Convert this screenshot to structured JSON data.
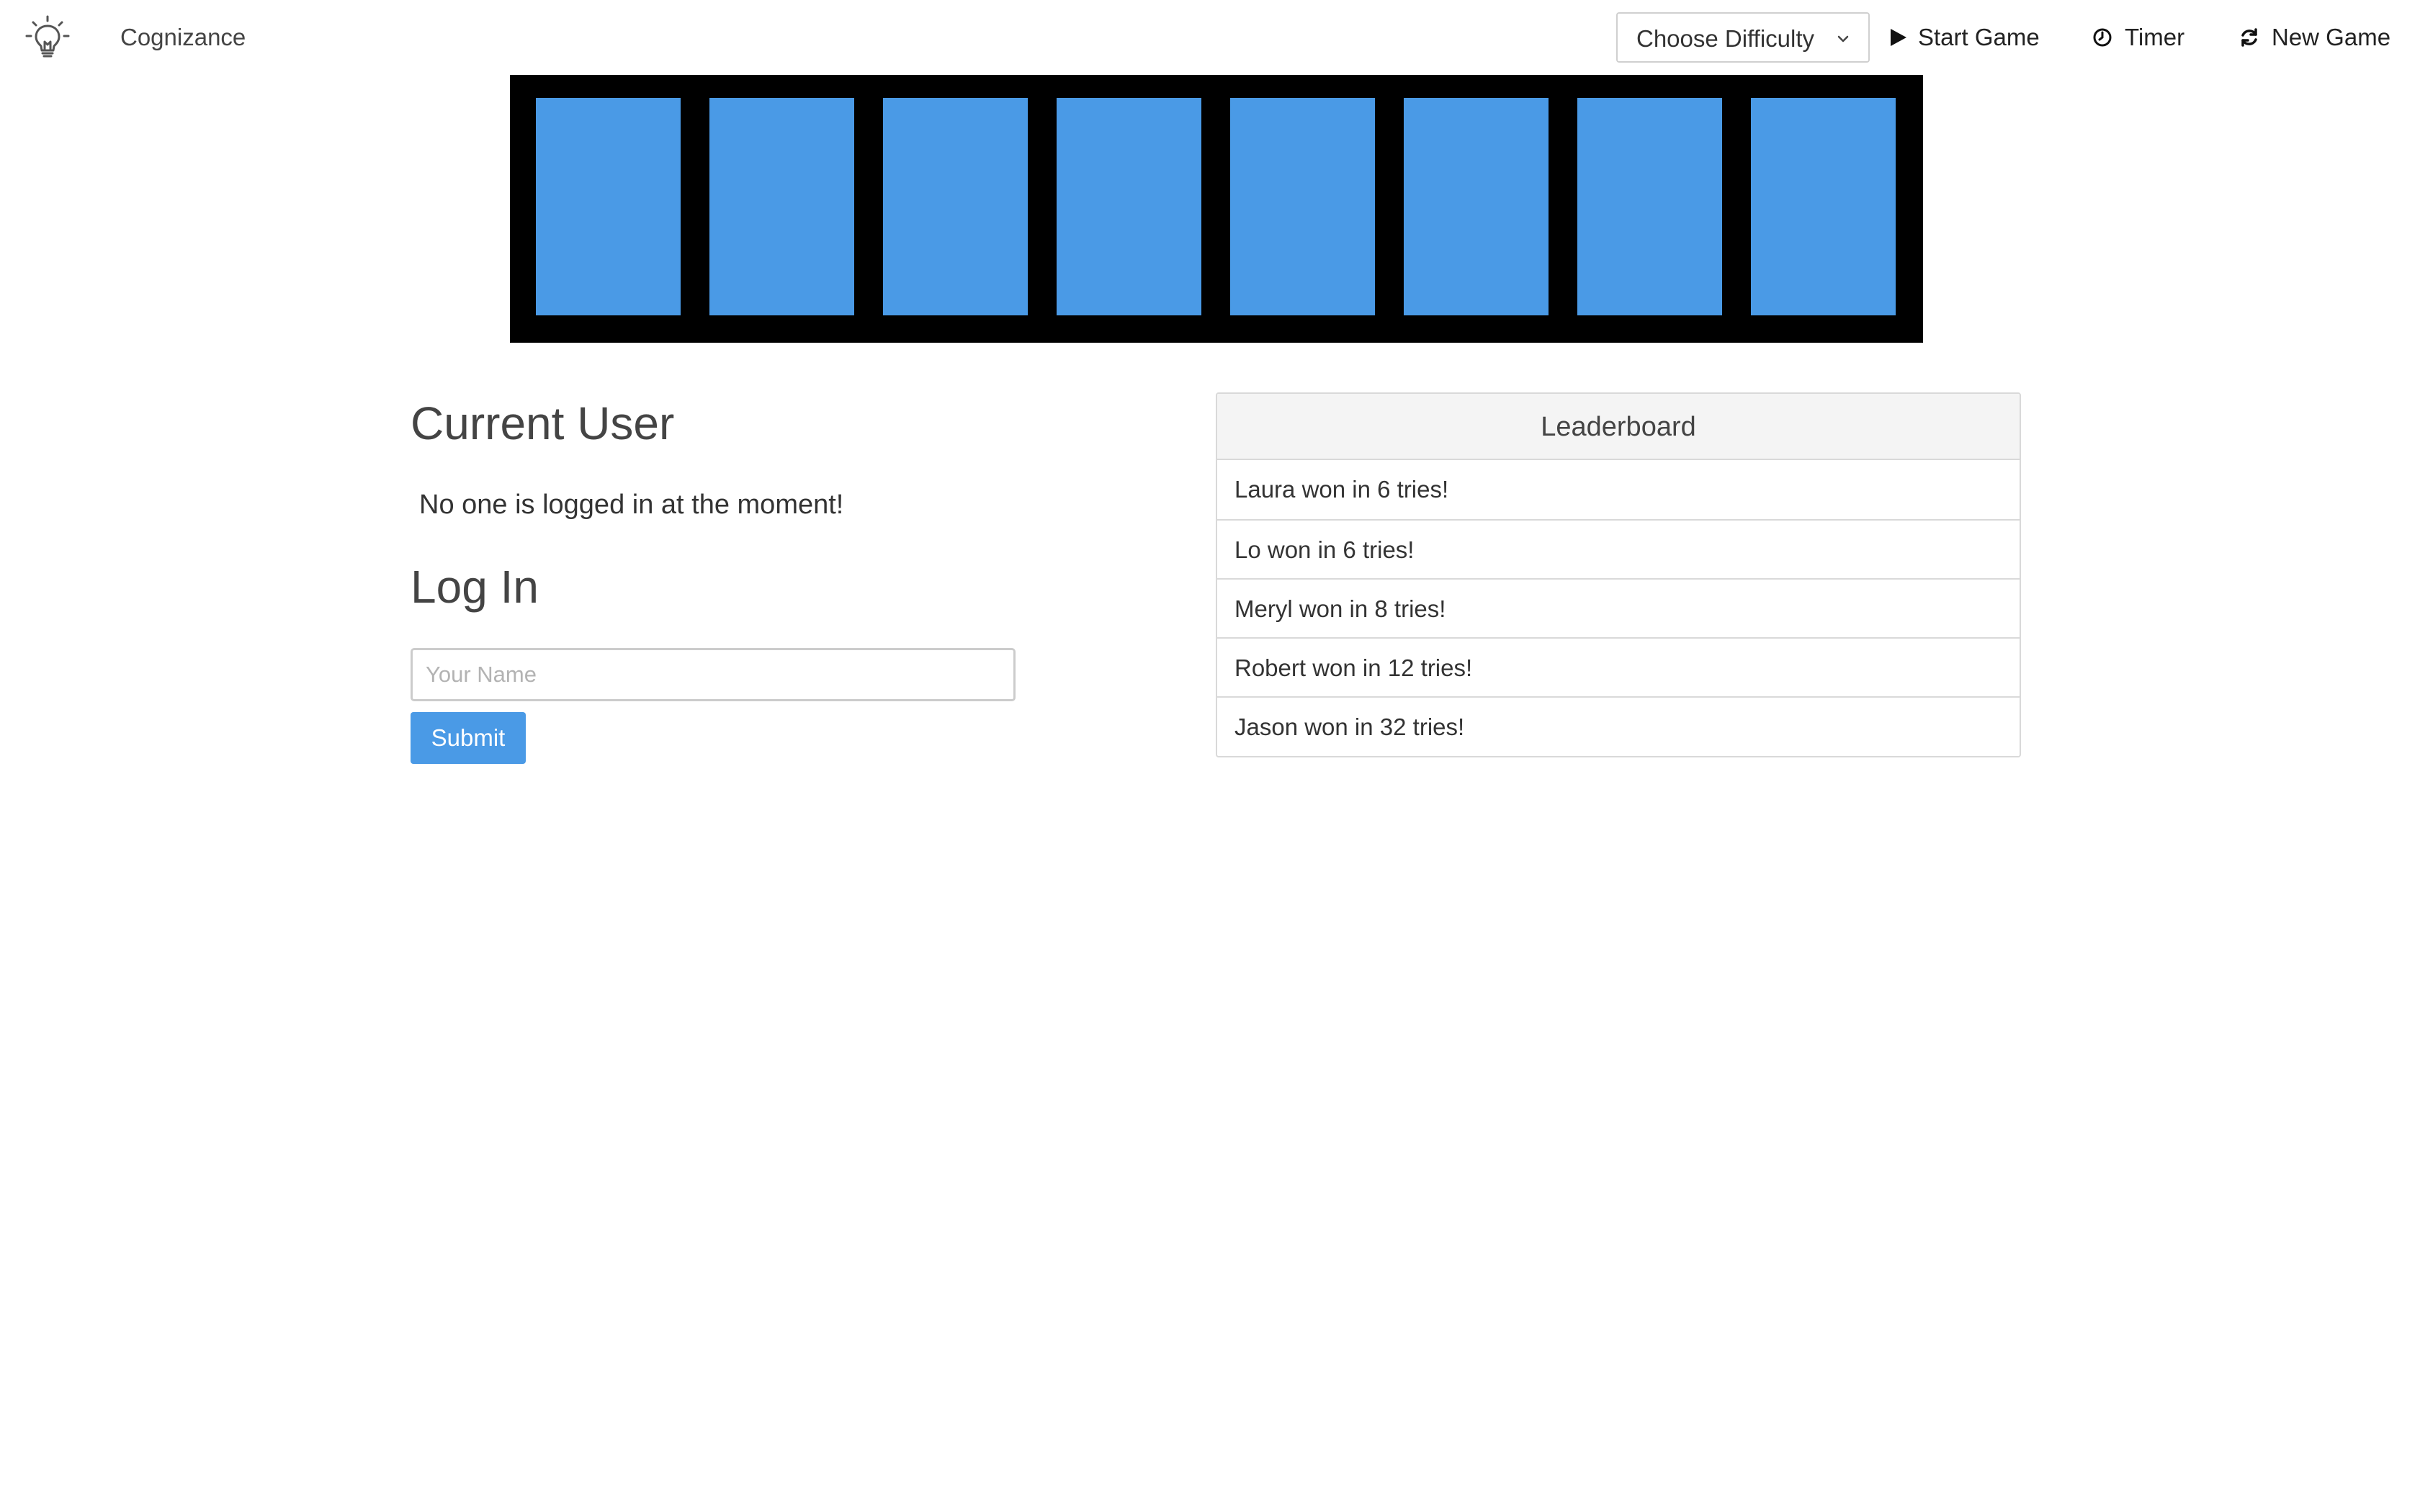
{
  "navbar": {
    "brand": "Cognizance",
    "logo_icon": "lightbulb-icon",
    "difficulty": {
      "label": "Choose Difficulty",
      "icon": "chevron-down-icon"
    },
    "start_game": {
      "label": "Start Game",
      "icon": "play-icon"
    },
    "timer": {
      "label": "Timer",
      "icon": "clock-icon"
    },
    "new_game": {
      "label": "New Game",
      "icon": "refresh-icon"
    }
  },
  "board": {
    "card_color": "#4a9ae6",
    "background_color": "#000000",
    "cards": [
      {
        "state": "face-down"
      },
      {
        "state": "face-down"
      },
      {
        "state": "face-down"
      },
      {
        "state": "face-down"
      },
      {
        "state": "face-down"
      },
      {
        "state": "face-down"
      },
      {
        "state": "face-down"
      },
      {
        "state": "face-down"
      }
    ]
  },
  "user": {
    "heading": "Current User",
    "status": "No one is logged in at the moment!"
  },
  "login": {
    "heading": "Log In",
    "name_placeholder": "Your Name",
    "name_value": "",
    "submit_label": "Submit"
  },
  "leaderboard": {
    "title": "Leaderboard",
    "entries": [
      "Laura won in 6 tries!",
      "Lo won in 6 tries!",
      "Meryl won in 8 tries!",
      "Robert won in 12 tries!",
      "Jason won in 32 tries!"
    ]
  },
  "colors": {
    "accent": "#4a9ae6"
  }
}
